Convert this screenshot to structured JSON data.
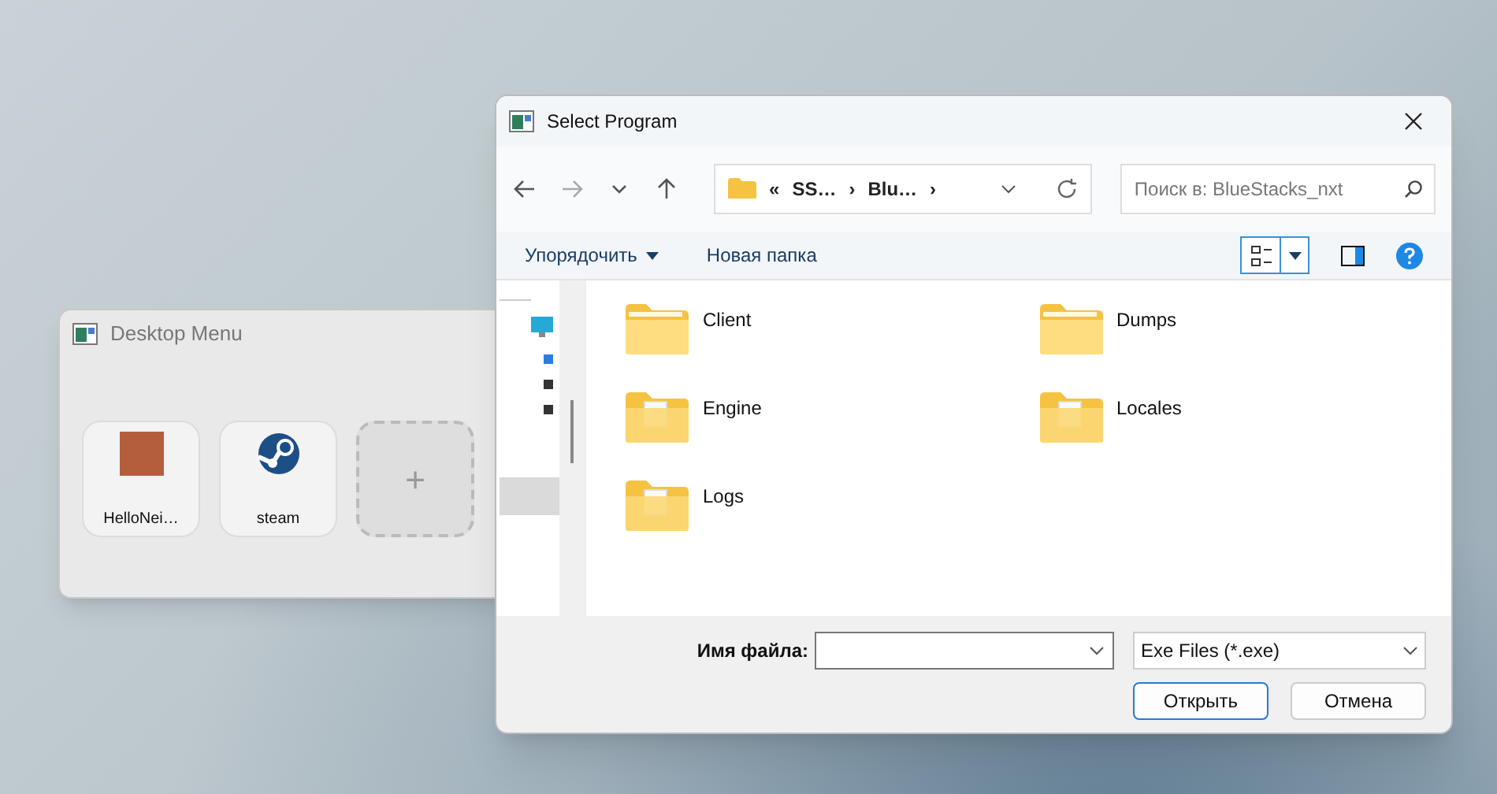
{
  "desktop_menu": {
    "title": "Desktop Menu",
    "apps": [
      {
        "label": "HelloNei…",
        "kind": "picture"
      },
      {
        "label": "steam",
        "kind": "steam"
      }
    ],
    "add_button": {
      "label": "+"
    }
  },
  "dialog": {
    "title": "Select Program",
    "breadcrumb": [
      "«",
      "SS…",
      "›",
      "Blu…",
      "›"
    ],
    "search": {
      "placeholder": "Поиск в: BlueStacks_nxt"
    },
    "toolbar": {
      "organize": "Упорядочить",
      "new_folder": "Новая папка"
    },
    "folders": [
      {
        "name": "Client",
        "kind": "plain"
      },
      {
        "name": "Dumps",
        "kind": "plain"
      },
      {
        "name": "Engine",
        "kind": "files"
      },
      {
        "name": "Locales",
        "kind": "files"
      },
      {
        "name": "Logs",
        "kind": "files"
      }
    ],
    "filename": {
      "label": "Имя файла:"
    },
    "filetype": {
      "value": "Exe Files (*.exe)"
    },
    "buttons": [
      {
        "label": "Открыть",
        "kind": "primary"
      },
      {
        "label": "Отмена",
        "kind": "secondary"
      }
    ]
  }
}
